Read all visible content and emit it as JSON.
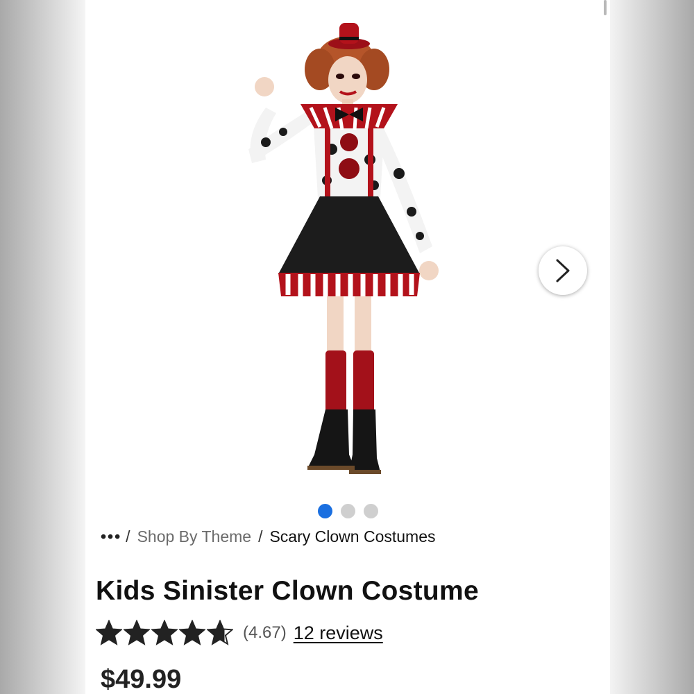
{
  "product": {
    "title": "Kids Sinister Clown Costume",
    "rating_value": "(4.67)",
    "reviews_label": "12 reviews",
    "rating": 4.67,
    "stars_max": 5,
    "price": "$49.99",
    "image_icon": "clown-costume-photo"
  },
  "breadcrumb": {
    "more": "•••",
    "separator": "/",
    "items": [
      "Shop By Theme",
      "Scary Clown Costumes"
    ]
  },
  "gallery": {
    "slide_count": 3,
    "active_index": 0,
    "next_icon": "chevron-right-icon"
  },
  "colors": {
    "accent": "#1a6fe0",
    "inactive_dot": "#cfcfcf",
    "text": "#111111",
    "muted": "#6b6b6b",
    "costume_red": "#b3121b",
    "costume_black": "#1a1a1a"
  }
}
